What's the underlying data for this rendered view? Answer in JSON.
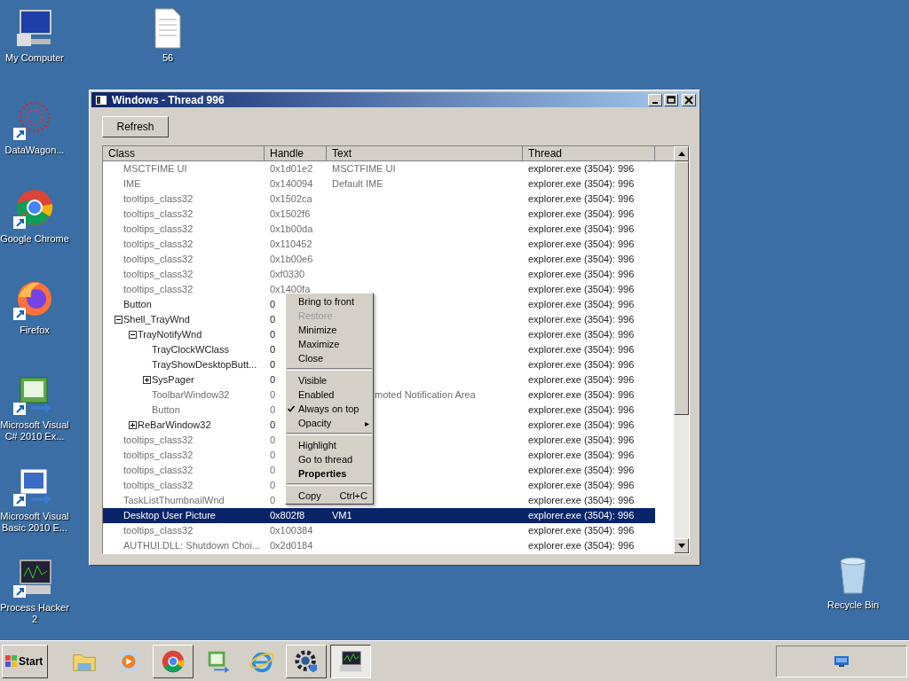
{
  "desktop_icons": [
    {
      "label": "My Computer",
      "kind": "computer",
      "shortcut": false
    },
    {
      "label": "56",
      "kind": "file",
      "shortcut": false
    },
    {
      "label": "DataWagon...",
      "kind": "dots",
      "shortcut": true
    },
    {
      "label": "Google Chrome",
      "kind": "chrome",
      "shortcut": true
    },
    {
      "label": "Firefox",
      "kind": "firefox",
      "shortcut": true
    },
    {
      "label": "Microsoft Visual C# 2010 Ex...",
      "kind": "csharp",
      "shortcut": true
    },
    {
      "label": "Microsoft Visual Basic 2010 E...",
      "kind": "vb",
      "shortcut": true
    },
    {
      "label": "Process Hacker 2",
      "kind": "hacker",
      "shortcut": true
    },
    {
      "label": "Recycle Bin",
      "kind": "bin",
      "shortcut": false
    }
  ],
  "window": {
    "title": "Windows - Thread 996",
    "refresh_button": "Refresh",
    "table": {
      "columns": [
        "Class",
        "Handle",
        "Text",
        "Thread"
      ],
      "rows": [
        {
          "class": "MSCTFIME UI",
          "handle": "0x1d01e2",
          "text": "MSCTFIME UI",
          "thread": "explorer.exe (3504): 996",
          "visible": false,
          "selected": false
        },
        {
          "class": "IME",
          "handle": "0x140094",
          "text": "Default IME",
          "thread": "explorer.exe (3504): 996",
          "visible": false,
          "selected": false
        },
        {
          "class": "tooltips_class32",
          "handle": "0x1502ca",
          "thread": "explorer.exe (3504): 996",
          "visible": false,
          "selected": false
        },
        {
          "class": "tooltips_class32",
          "handle": "0x1502f6",
          "thread": "explorer.exe (3504): 996",
          "visible": false,
          "selected": false
        },
        {
          "class": "tooltips_class32",
          "handle": "0x1b00da",
          "thread": "explorer.exe (3504): 996",
          "visible": false,
          "selected": false
        },
        {
          "class": "tooltips_class32",
          "handle": "0x110452",
          "thread": "explorer.exe (3504): 996",
          "visible": false,
          "selected": false
        },
        {
          "class": "tooltips_class32",
          "handle": "0x1b00e6",
          "thread": "explorer.exe (3504): 996",
          "visible": false,
          "selected": false
        },
        {
          "class": "tooltips_class32",
          "handle": "0xf0330",
          "thread": "explorer.exe (3504): 996",
          "visible": false,
          "selected": false
        },
        {
          "class": "tooltips_class32",
          "handle": "0x1400fa",
          "thread": "explorer.exe (3504): 996",
          "visible": false,
          "selected": false
        },
        {
          "class": "Button",
          "handle": "0",
          "thread": "explorer.exe (3504): 996",
          "visible": true,
          "selected": false
        },
        {
          "class": "Shell_TrayWnd",
          "handle": "0",
          "thread": "explorer.exe (3504): 996",
          "visible": true,
          "selected": false,
          "expanded": true,
          "children": [
            {
              "class": "TrayNotifyWnd",
              "handle": "0",
              "thread": "explorer.exe (3504): 996",
              "visible": true,
              "selected": false,
              "expanded": true,
              "children": [
                {
                  "class": "TrayClockWClass",
                  "handle": "0",
                  "thread": "explorer.exe (3504): 996",
                  "visible": true,
                  "selected": false
                },
                {
                  "class": "TrayShowDesktopButt...",
                  "handle": "0",
                  "thread": "explorer.exe (3504): 996",
                  "visible": true,
                  "selected": false
                },
                {
                  "class": "SysPager",
                  "handle": "0",
                  "thread": "explorer.exe (3504): 996",
                  "visible": true,
                  "selected": false,
                  "expanded": false
                },
                {
                  "class": "ToolbarWindow32",
                  "handle": "0",
                  "text": "moted Notification Area",
                  "text_behind_menu": true,
                  "thread": "explorer.exe (3504): 996",
                  "visible": false,
                  "selected": false
                },
                {
                  "class": "Button",
                  "handle": "0",
                  "thread": "explorer.exe (3504): 996",
                  "visible": false,
                  "selected": false
                }
              ]
            },
            {
              "class": "ReBarWindow32",
              "handle": "0",
              "thread": "explorer.exe (3504): 996",
              "visible": true,
              "selected": false,
              "expanded": false
            }
          ]
        },
        {
          "class": "tooltips_class32",
          "handle": "0",
          "thread": "explorer.exe (3504): 996",
          "visible": false,
          "selected": false
        },
        {
          "class": "tooltips_class32",
          "handle": "0",
          "thread": "explorer.exe (3504): 996",
          "visible": false,
          "selected": false
        },
        {
          "class": "tooltips_class32",
          "handle": "0",
          "thread": "explorer.exe (3504): 996",
          "visible": false,
          "selected": false
        },
        {
          "class": "tooltips_class32",
          "handle": "0",
          "thread": "explorer.exe (3504): 996",
          "visible": false,
          "selected": false
        },
        {
          "class": "TaskListThumbnailWnd",
          "handle": "0",
          "thread": "explorer.exe (3504): 996",
          "visible": false,
          "selected": false
        },
        {
          "class": "Desktop User Picture",
          "handle": "0x802f8",
          "text": "VM1",
          "thread": "explorer.exe (3504): 996",
          "visible": false,
          "selected": true
        },
        {
          "class": "tooltips_class32",
          "handle": "0x100384",
          "thread": "explorer.exe (3504): 996",
          "visible": false,
          "selected": false
        },
        {
          "class": "AUTHUI.DLL: Shutdown Choi...",
          "handle": "0x2d0184",
          "thread": "explorer.exe (3504): 996",
          "visible": false,
          "selected": false
        }
      ]
    }
  },
  "context_menu": [
    {
      "kind": "item",
      "label": "Bring to front",
      "disabled": false
    },
    {
      "kind": "item",
      "label": "Restore",
      "disabled": true
    },
    {
      "kind": "item",
      "label": "Minimize",
      "disabled": false
    },
    {
      "kind": "item",
      "label": "Maximize",
      "disabled": false
    },
    {
      "kind": "item",
      "label": "Close",
      "disabled": false
    },
    {
      "kind": "separator"
    },
    {
      "kind": "check",
      "label": "Visible",
      "checked": false
    },
    {
      "kind": "check",
      "label": "Enabled",
      "checked": false
    },
    {
      "kind": "check",
      "label": "Always on top",
      "checked": true
    },
    {
      "kind": "submenu",
      "label": "Opacity",
      "arrow": "▸"
    },
    {
      "kind": "separator"
    },
    {
      "kind": "item",
      "label": "Highlight",
      "disabled": false
    },
    {
      "kind": "item",
      "label": "Go to thread",
      "disabled": false
    },
    {
      "kind": "default",
      "label": "Properties"
    },
    {
      "kind": "separator"
    },
    {
      "kind": "item",
      "label": "Copy",
      "shortcut": "Ctrl+C",
      "disabled": false
    }
  ],
  "taskbar": {
    "start": "Start",
    "apps": [
      {
        "kind": "folder",
        "running": false,
        "selected": false
      },
      {
        "kind": "media",
        "running": false,
        "selected": false
      },
      {
        "kind": "chrome",
        "running": true,
        "selected": false
      },
      {
        "kind": "csharp",
        "running": false,
        "selected": false
      },
      {
        "kind": "ie",
        "running": false,
        "selected": false
      },
      {
        "kind": "gear",
        "running": true,
        "selected": false
      },
      {
        "kind": "monitor",
        "running": true,
        "selected": true
      }
    ]
  }
}
